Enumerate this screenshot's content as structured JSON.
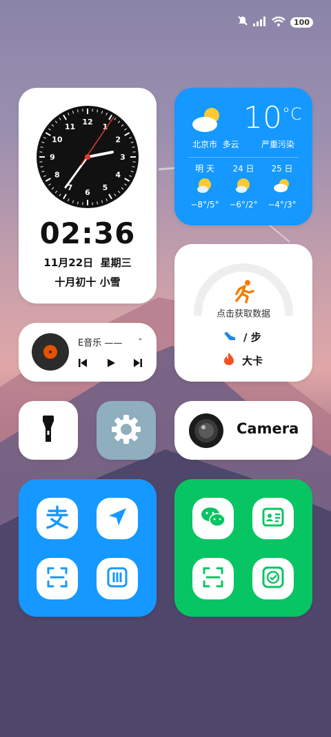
{
  "status_bar": {
    "battery": "100",
    "icons": [
      "mute-icon",
      "signal-icon",
      "wifi-icon"
    ]
  },
  "clock": {
    "time": "02:36",
    "date": "11月22日",
    "weekday": "星期三",
    "lunar": "十月初十",
    "solar_term": "小雪",
    "dial_numbers": [
      "12",
      "1",
      "2",
      "3",
      "4",
      "5",
      "6",
      "7",
      "8",
      "9",
      "10",
      "11"
    ]
  },
  "weather": {
    "temperature": "10",
    "unit": "°C",
    "city": "北京市",
    "condition": "多云",
    "air_quality": "严重污染",
    "color": "#1598ff",
    "forecast": [
      {
        "day": "明 天",
        "range": "−8°/5°"
      },
      {
        "day": "24 日",
        "range": "−6°/2°"
      },
      {
        "day": "25 日",
        "range": "−4°/3°"
      }
    ]
  },
  "fitness": {
    "prompt": "点击获取数据",
    "steps_label": "/ 步",
    "calories_label": "大卡",
    "accent": "#f57c00"
  },
  "music": {
    "title": "E音乐 ——",
    "dash": "-"
  },
  "apps": {
    "camera_label": "Camera"
  },
  "blue_group_color": "#1598ff",
  "green_group_color": "#08c563"
}
